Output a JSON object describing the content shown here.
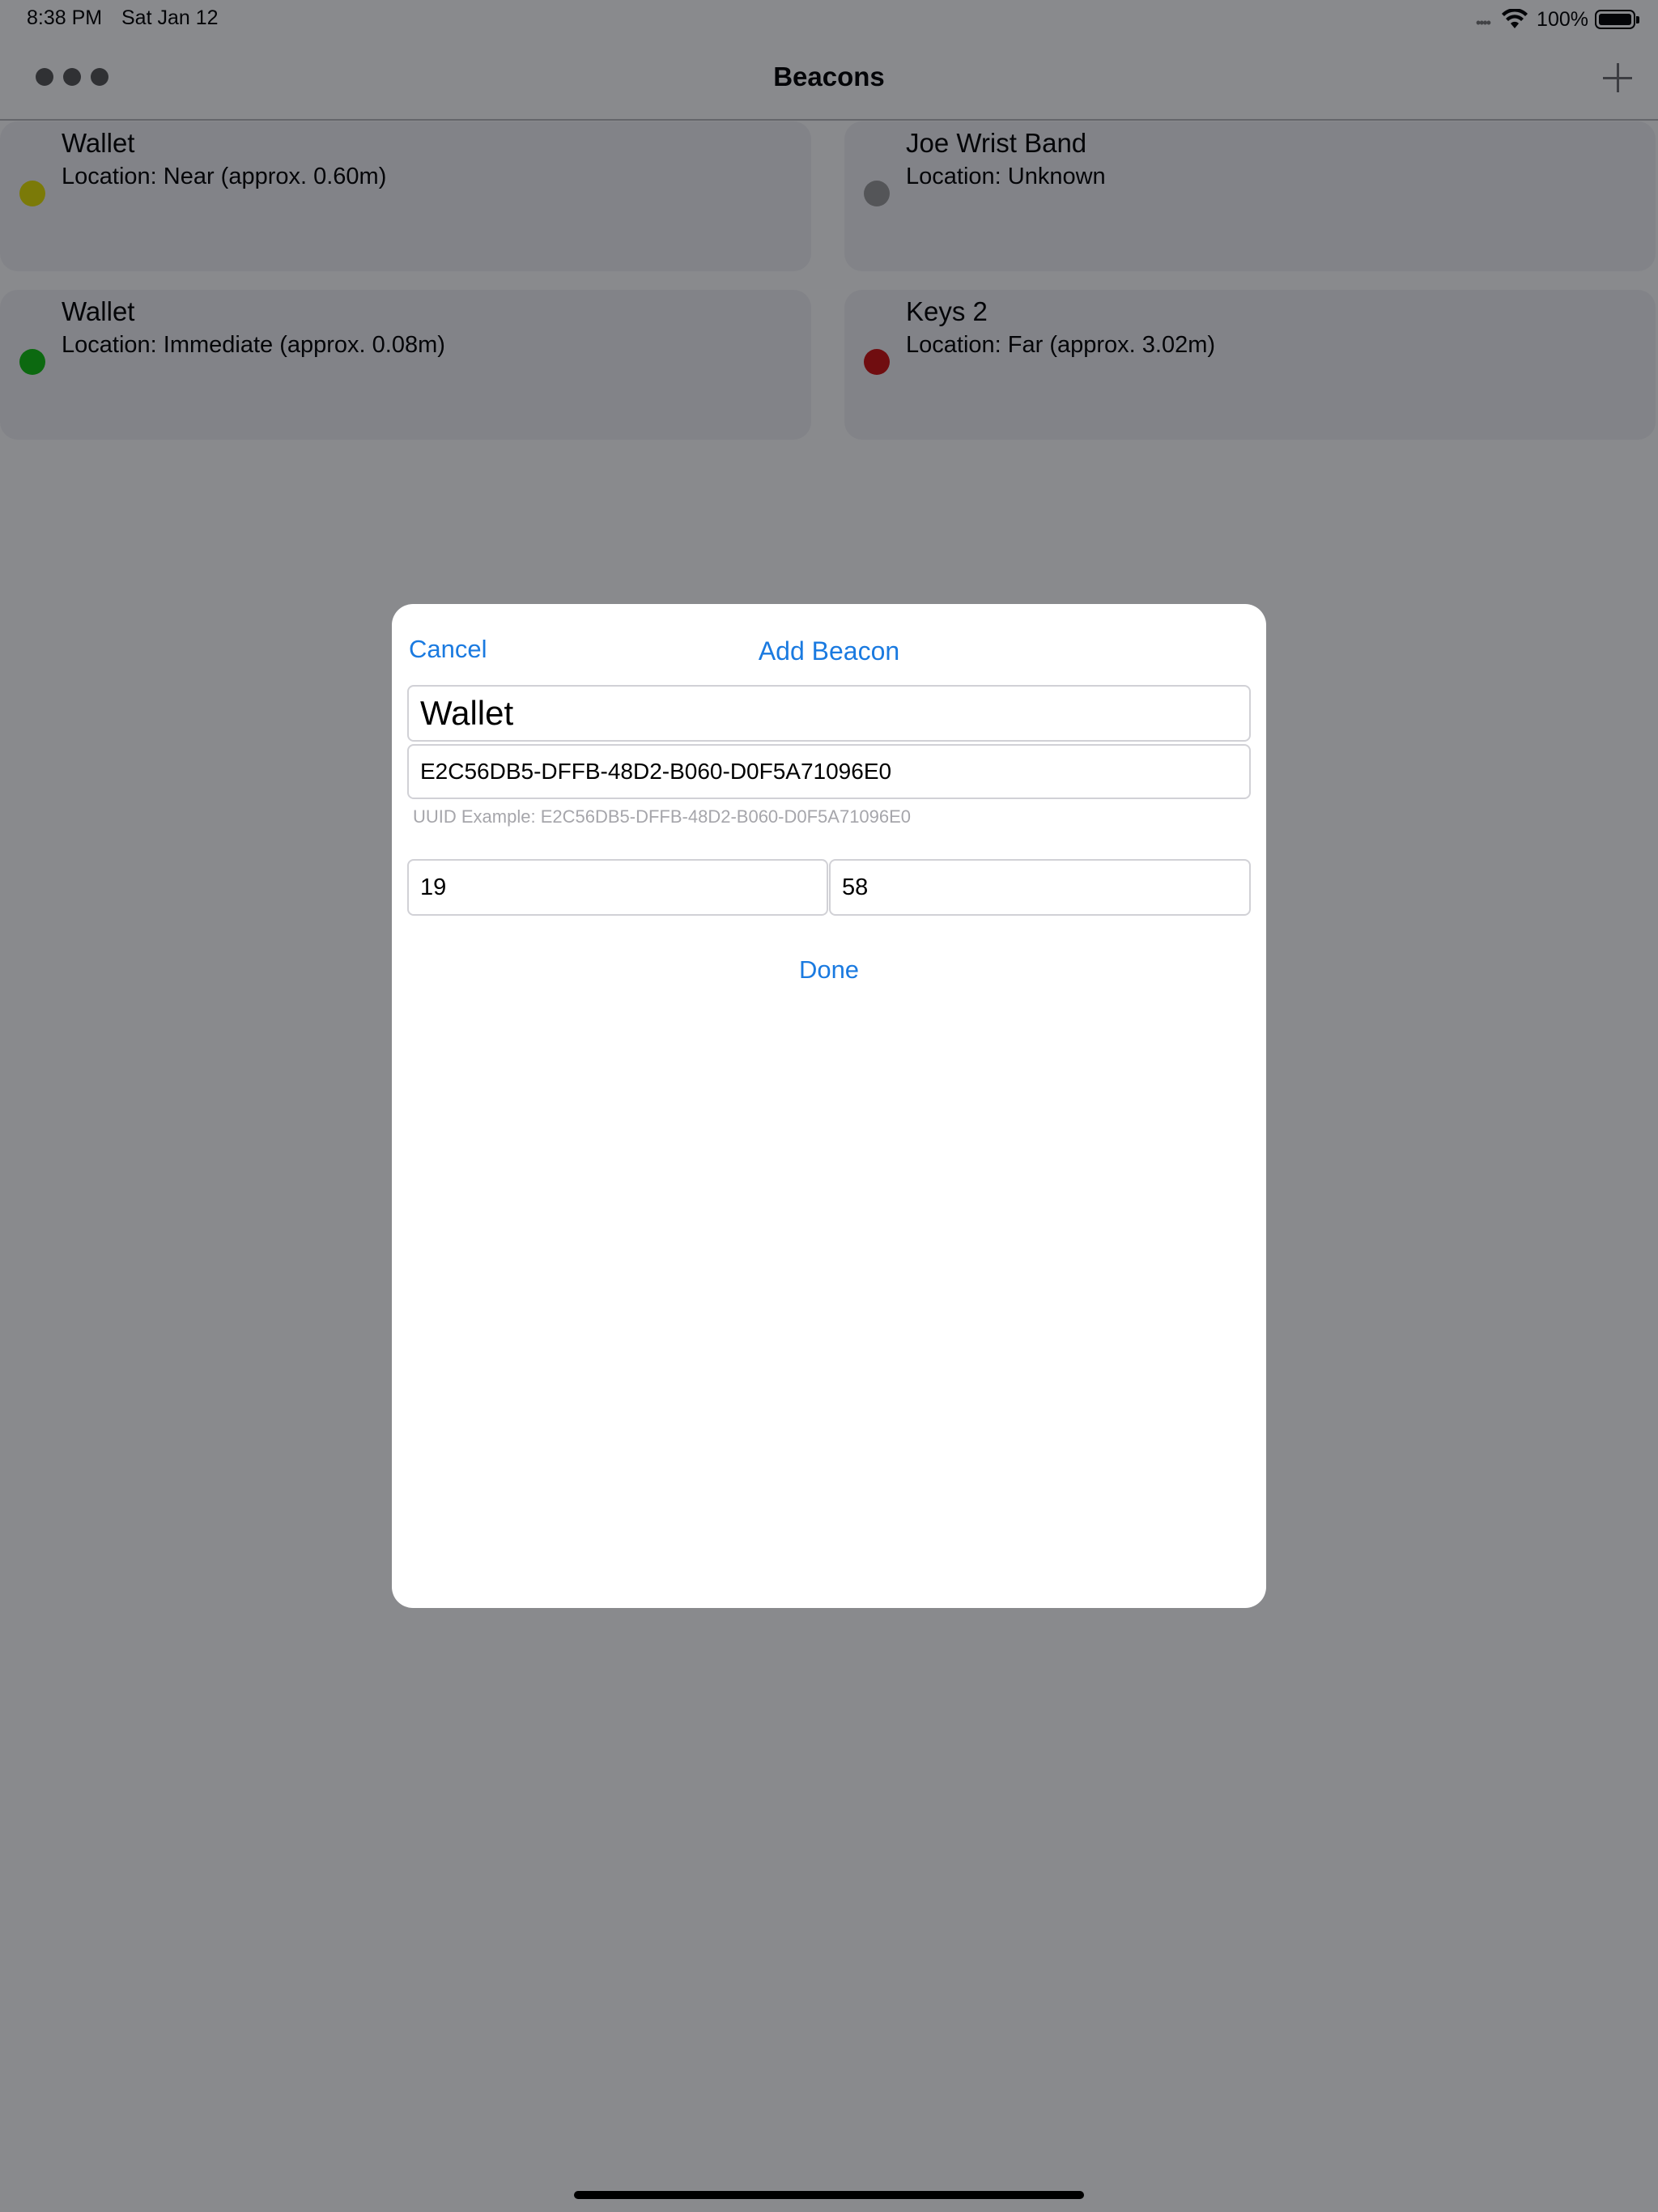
{
  "status_bar": {
    "time": "8:38 PM",
    "date": "Sat Jan 12",
    "signal": "••••",
    "battery_percent": "100%",
    "battery_level": 1.0
  },
  "nav": {
    "title": "Beacons"
  },
  "beacons": [
    {
      "name": "Wallet",
      "location": "Location: Near (approx. 0.60m)",
      "status_color": "#e4e000"
    },
    {
      "name": "Joe Wrist Band",
      "location": "Location: Unknown",
      "status_color": "#9a9a9a"
    },
    {
      "name": "Wallet",
      "location": "Location: Immediate (approx. 0.08m)",
      "status_color": "#10c010"
    },
    {
      "name": "Keys 2",
      "location": "Location: Far (approx. 3.02m)",
      "status_color": "#d01010"
    }
  ],
  "modal": {
    "cancel_label": "Cancel",
    "title": "Add Beacon",
    "name_value": "Wallet",
    "uuid_value": "E2C56DB5-DFFB-48D2-B060-D0F5A71096E0",
    "uuid_hint": "UUID Example: E2C56DB5-DFFB-48D2-B060-D0F5A71096E0",
    "major_value": "19",
    "minor_value": "58",
    "done_label": "Done"
  },
  "colors": {
    "accent": "#1a7ae0",
    "dim_overlay": "rgba(8,10,16,0.48)"
  }
}
